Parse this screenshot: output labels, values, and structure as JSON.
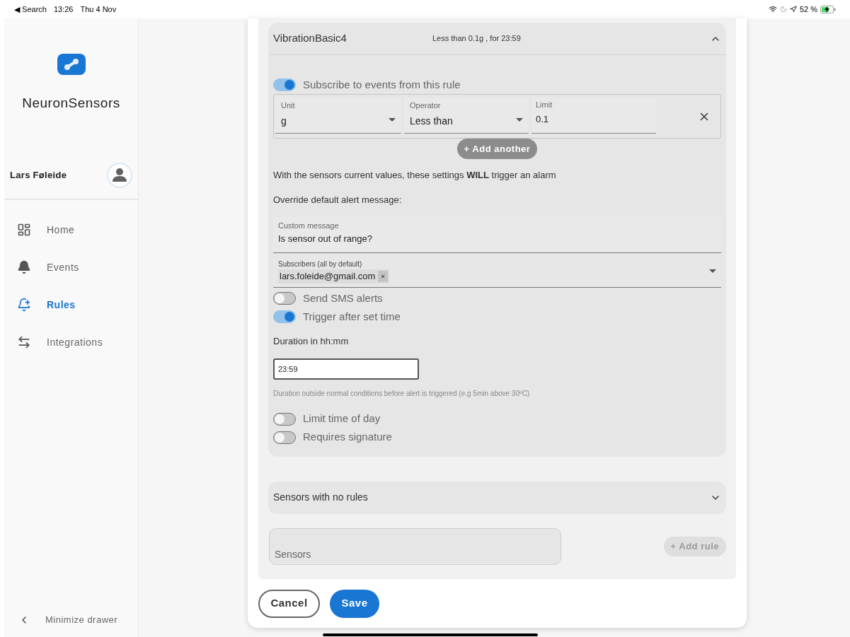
{
  "status_bar": {
    "back": "◀ Search",
    "time": "13:26",
    "date": "Thu 4 Nov",
    "battery": "52 %"
  },
  "sidebar": {
    "app_name": "NeuronSensors",
    "user": "Lars Føleide",
    "items": [
      {
        "label": "Home",
        "kind": "home",
        "selected": false
      },
      {
        "label": "Events",
        "kind": "events",
        "selected": false
      },
      {
        "label": "Rules",
        "kind": "rules",
        "selected": true
      },
      {
        "label": "Integrations",
        "kind": "integrations",
        "selected": false
      }
    ],
    "minimize": "Minimize drawer"
  },
  "rule": {
    "title": "VibrationBasic4",
    "summary": "Less than 0.1g , for 23:59",
    "expanded": true,
    "subscribe": {
      "label": "Subscribe to events from this rule",
      "on": true
    },
    "condition": {
      "unit": {
        "label": "Unit",
        "value": "g"
      },
      "operator": {
        "label": "Operator",
        "value": "Less than"
      },
      "limit": {
        "label": "Limit",
        "value": "0.1"
      }
    },
    "add_another": "+ Add another",
    "notice": "With the sensors current values, these settings **WILL** trigger an alarm",
    "override_label": "Override default alert message:",
    "custom_message": {
      "label": "Custom message",
      "value": "Is sensor out of range?"
    },
    "subscribers": {
      "label": "Subscribers (all by default)",
      "chips": [
        "lars.foleide@gmail.com"
      ]
    },
    "toggles": [
      {
        "label": "Send SMS alerts",
        "on": false
      },
      {
        "label": "Trigger after set time",
        "on": true
      }
    ],
    "duration": {
      "label": "Duration in hh:mm",
      "value": "23:59",
      "help": "Duration outside normal conditions before alert is triggered (e.g 5min above 30ºC)"
    },
    "more_toggles": [
      {
        "label": "Limit time of day",
        "on": false
      },
      {
        "label": "Requires signature",
        "on": false
      }
    ]
  },
  "sensors_no_rules": {
    "title": "Sensors with no rules",
    "expanded": false
  },
  "sensors_field": {
    "placeholder": "Sensors"
  },
  "add_rule": {
    "label": "+ Add rule",
    "disabled": true
  },
  "buttons": {
    "cancel": "Cancel",
    "save": "Save"
  }
}
